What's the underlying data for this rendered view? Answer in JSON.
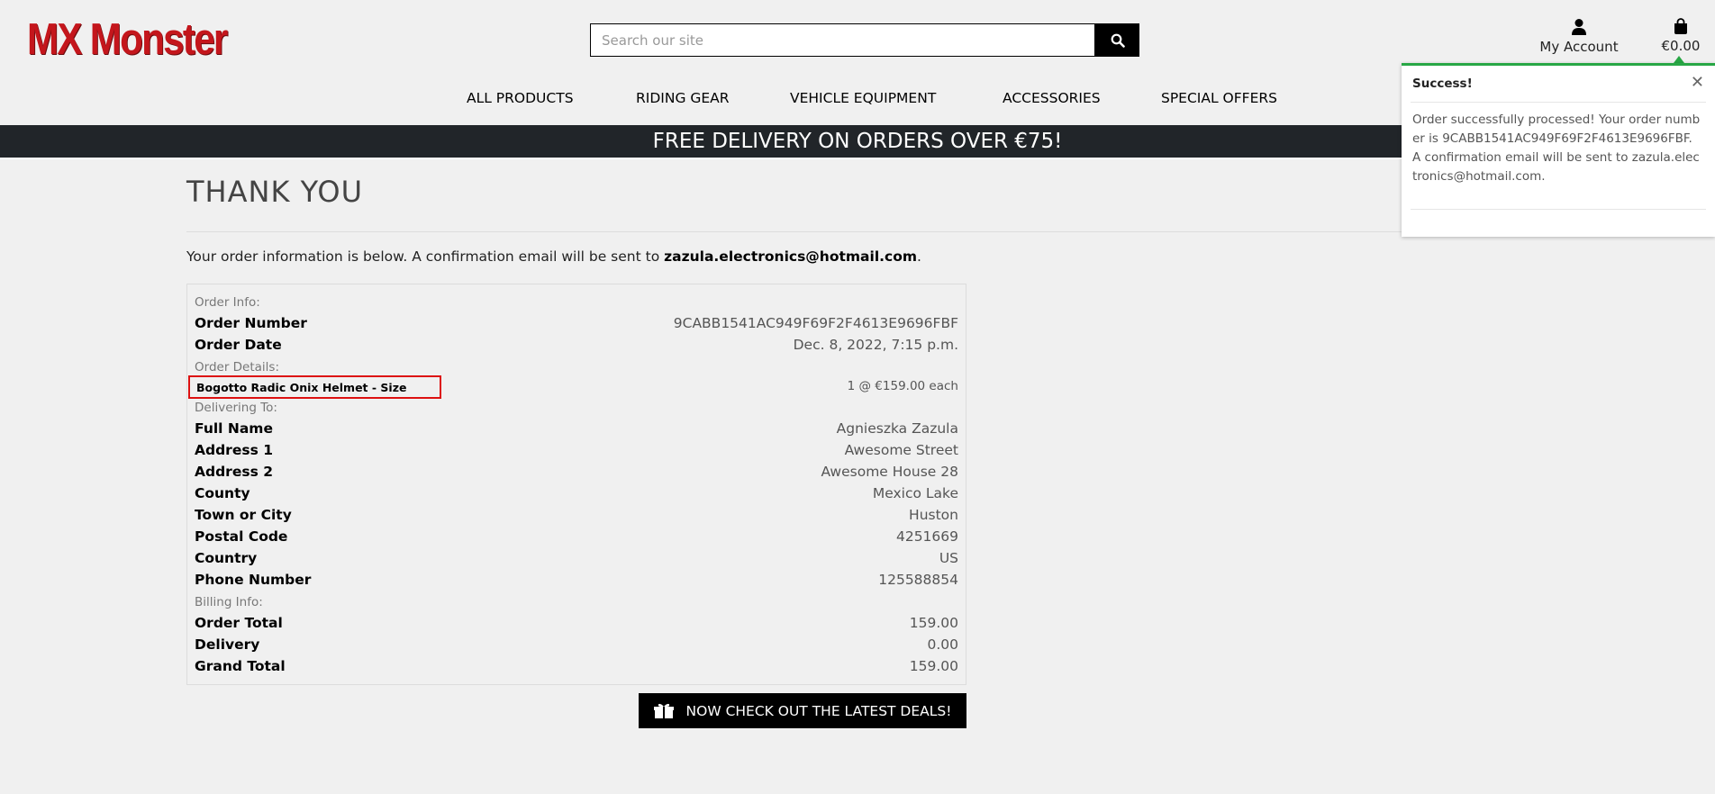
{
  "brand": {
    "logo_text": "MX Monster",
    "logo_color": "#c4161c"
  },
  "search": {
    "placeholder": "Search our site"
  },
  "account": {
    "label": "My Account"
  },
  "bag": {
    "total": "€0.00"
  },
  "nav": {
    "items": [
      "ALL PRODUCTS",
      "RIDING GEAR",
      "VEHICLE EQUIPMENT",
      "ACCESSORIES",
      "SPECIAL OFFERS"
    ]
  },
  "banner": {
    "text": "FREE DELIVERY ON ORDERS OVER €75!"
  },
  "page": {
    "title": "THANK YOU",
    "intro_text": "Your order information is below. A confirmation email will be sent to ",
    "intro_email": "zazula.electronics@hotmail.com",
    "intro_end": "."
  },
  "order": {
    "info_heading": "Order Info:",
    "number_label": "Order Number",
    "number_value": "9CABB1541AC949F69F2F4613E9696FBF",
    "date_label": "Order Date",
    "date_value": "Dec. 8, 2022, 7:15 p.m.",
    "details_heading": "Order Details:",
    "item_name": "Bogotto Radic Onix Helmet - Size",
    "item_qty": "1 @ €159.00 each",
    "delivering_heading": "Delivering To:",
    "delivery": [
      {
        "label": "Full Name",
        "value": "Agnieszka Zazula"
      },
      {
        "label": "Address 1",
        "value": "Awesome Street"
      },
      {
        "label": "Address 2",
        "value": "Awesome House 28"
      },
      {
        "label": "County",
        "value": "Mexico Lake"
      },
      {
        "label": "Town or City",
        "value": "Huston"
      },
      {
        "label": "Postal Code",
        "value": "4251669"
      },
      {
        "label": "Country",
        "value": "US"
      },
      {
        "label": "Phone Number",
        "value": "125588854"
      }
    ],
    "billing_heading": "Billing Info:",
    "billing": [
      {
        "label": "Order Total",
        "value": "159.00"
      },
      {
        "label": "Delivery",
        "value": "0.00"
      },
      {
        "label": "Grand Total",
        "value": "159.00"
      }
    ]
  },
  "deals_button": {
    "label": "NOW CHECK OUT THE LATEST DEALS!"
  },
  "toast": {
    "title": "Success!",
    "message": "Order successfully processed! Your order number is 9CABB1541AC949F69F2F4613E9696FBF. A confirmation email will be sent to zazula.electronics@hotmail.com.",
    "accent_color": "#28a745"
  },
  "colors": {
    "banner_bg": "#212529",
    "page_bg": "#f0f0f0",
    "highlight": "#dd1111"
  }
}
